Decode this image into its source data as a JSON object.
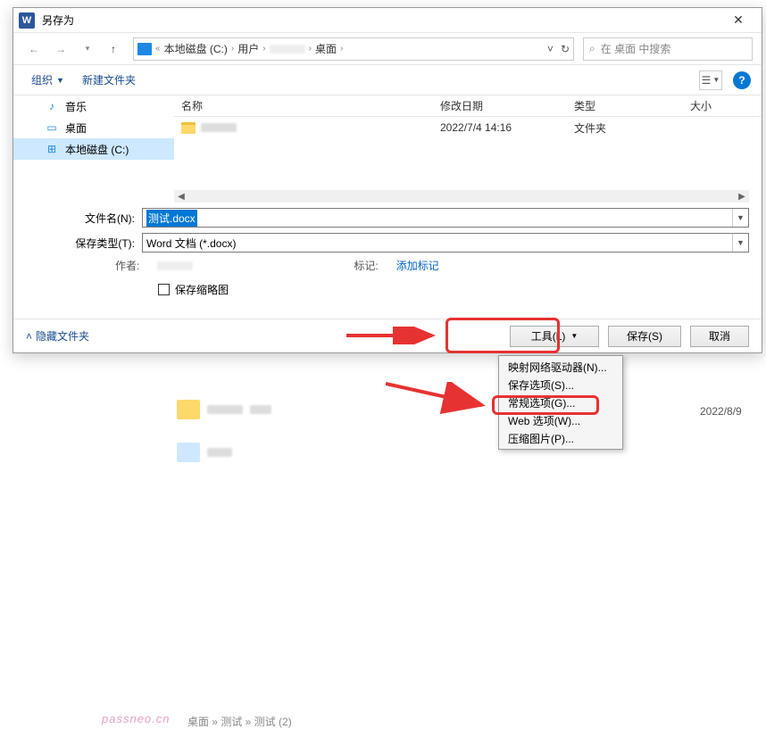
{
  "titlebar": {
    "title": "另存为",
    "word_icon": "W"
  },
  "nav": {
    "breadcrumb": [
      "本地磁盘 (C:)",
      "用户",
      "",
      "桌面"
    ],
    "search_placeholder": "在 桌面 中搜索",
    "search_icon": "⌕"
  },
  "toolbar": {
    "organize": "组织",
    "new_folder": "新建文件夹",
    "help": "?"
  },
  "sidebar": {
    "items": [
      {
        "icon": "♪",
        "label": "音乐",
        "color": "#1e88e5"
      },
      {
        "icon": "▭",
        "label": "桌面",
        "color": "#1e88e5"
      },
      {
        "icon": "⊞",
        "label": "本地磁盘 (C:)",
        "color": "#1e88e5",
        "selected": true
      }
    ]
  },
  "columns": {
    "name": "名称",
    "date": "修改日期",
    "type": "类型",
    "size": "大小"
  },
  "rows": [
    {
      "name_blurred": true,
      "date": "2022/7/4 14:16",
      "type": "文件夹"
    }
  ],
  "form": {
    "filename_label": "文件名(N):",
    "filename_value": "测试.docx",
    "filetype_label": "保存类型(T):",
    "filetype_value": "Word 文档 (*.docx)",
    "author_label": "作者:",
    "tags_label": "标记:",
    "tags_value": "添加标记",
    "thumb_label": "保存缩略图"
  },
  "footer": {
    "hide": "隐藏文件夹",
    "tools": "工具(L)",
    "save": "保存(S)",
    "cancel": "取消"
  },
  "menu": {
    "items": [
      "映射网络驱动器(N)...",
      "保存选项(S)...",
      "常规选项(G)...",
      "Web 选项(W)...",
      "压缩图片(P)..."
    ]
  },
  "background": {
    "watermark": "passneo.cn",
    "crumb": "桌面 » 测试 » 测试 (2)",
    "date": "2022/8/9"
  }
}
